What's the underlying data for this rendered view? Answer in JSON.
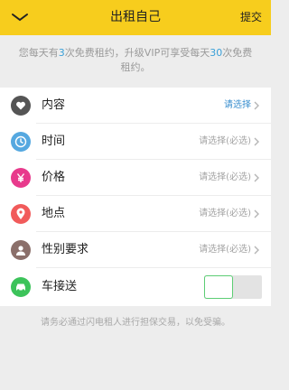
{
  "header": {
    "title": "出租自己",
    "submit_label": "提交",
    "bg_color": "#f7cd1d"
  },
  "notice": {
    "part1": "您每天有",
    "free_count": "3",
    "part2": "次免费租约，升级VIP可享受每天",
    "vip_count": "30",
    "part3": "次免费租约。"
  },
  "form": {
    "rows": [
      {
        "label": "内容",
        "value": "请选择",
        "icon": "heart-icon",
        "icon_color": "#555555"
      },
      {
        "label": "时间",
        "value": "请选择(必选)",
        "icon": "clock-icon",
        "icon_color": "#55a8e0"
      },
      {
        "label": "价格",
        "value": "请选择(必选)",
        "icon": "yen-icon",
        "icon_color": "#e83a8c"
      },
      {
        "label": "地点",
        "value": "请选择(必选)",
        "icon": "location-pin-icon",
        "icon_color": "#f15b5b"
      },
      {
        "label": "性别要求",
        "value": "请选择(必选)",
        "icon": "person-icon",
        "icon_color": "#8b6f6a"
      }
    ],
    "pickup": {
      "label": "车接送",
      "icon": "car-icon",
      "icon_color": "#3cc35a",
      "enabled": false
    }
  },
  "footer_note": "请务必通过闪电租人进行担保交易，以免受骗。"
}
